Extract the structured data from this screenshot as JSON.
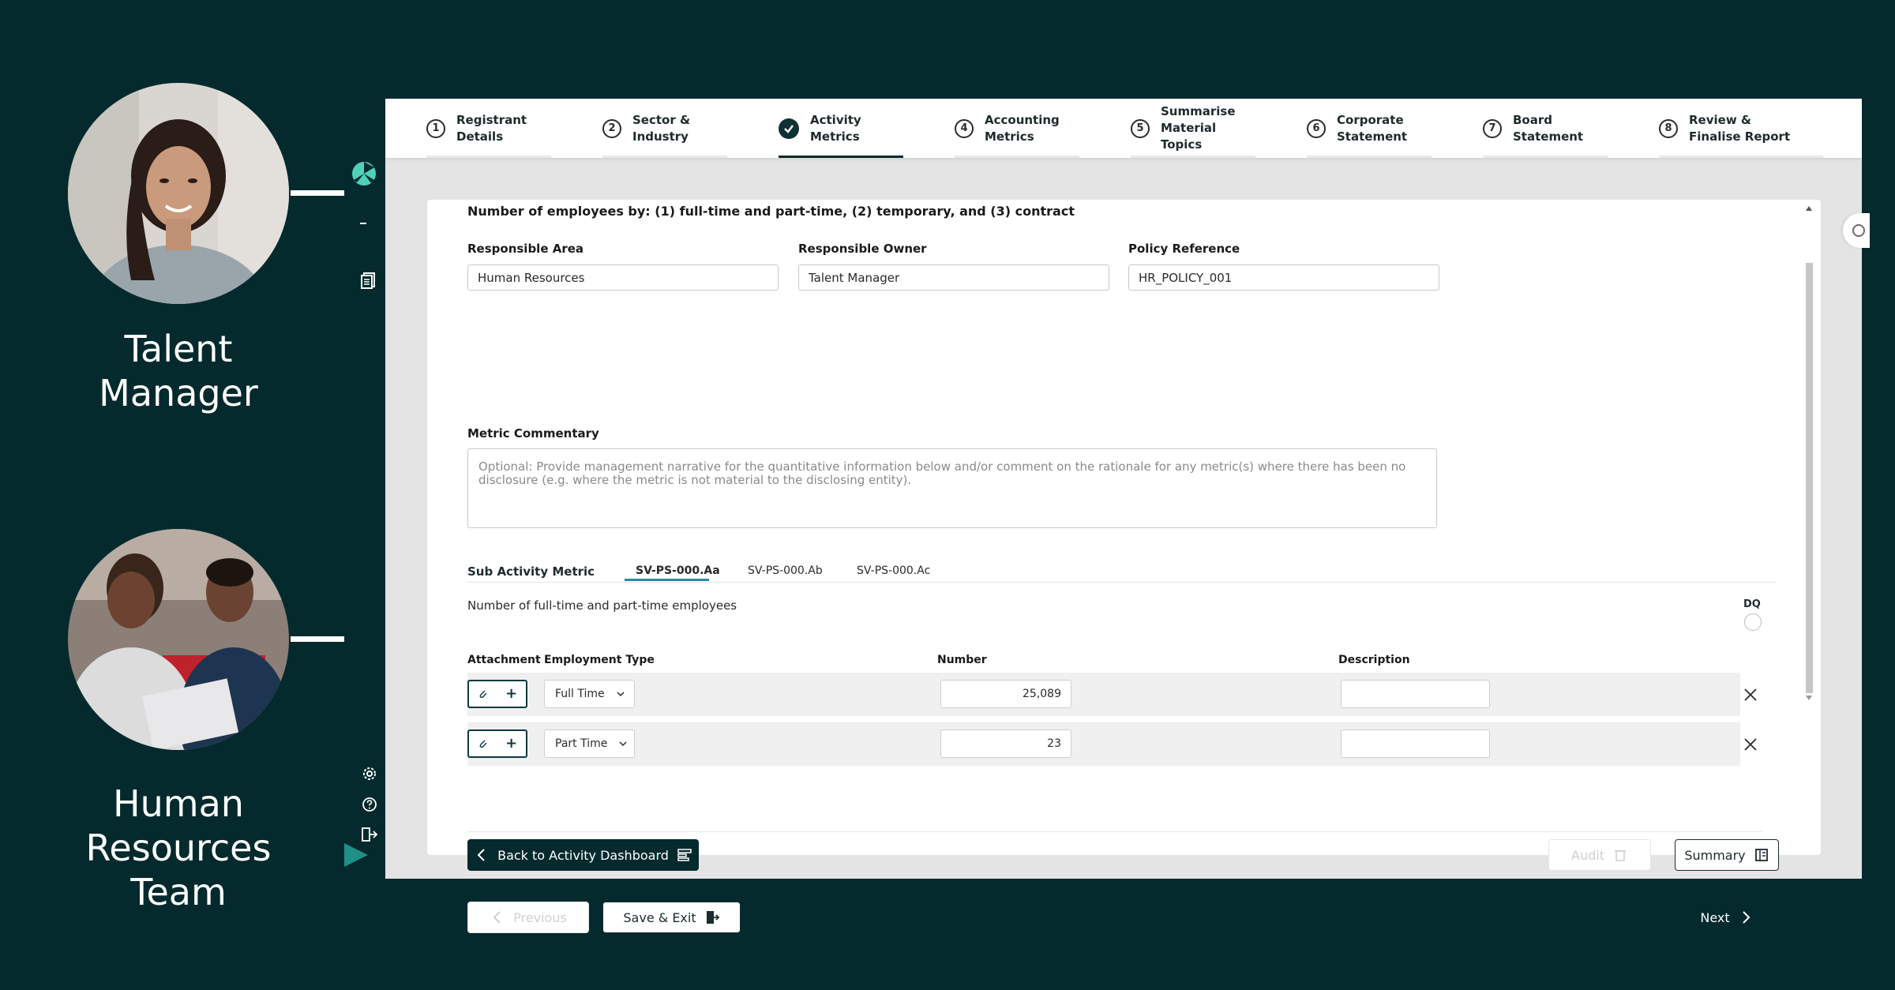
{
  "personas": [
    {
      "name": "Talent\nManager"
    },
    {
      "name": "Human\nResources\nTeam"
    }
  ],
  "steps": [
    {
      "number": "1",
      "label": "Registrant\nDetails",
      "state": "pending"
    },
    {
      "number": "2",
      "label": "Sector &\nIndustry",
      "state": "pending"
    },
    {
      "number": "3",
      "label": "Activity\nMetrics",
      "state": "active"
    },
    {
      "number": "4",
      "label": "Accounting\nMetrics",
      "state": "pending"
    },
    {
      "number": "5",
      "label": "Summarise\nMaterial Topics",
      "state": "pending"
    },
    {
      "number": "6",
      "label": "Corporate\nStatement",
      "state": "pending"
    },
    {
      "number": "7",
      "label": "Board\nStatement",
      "state": "pending"
    },
    {
      "number": "8",
      "label": "Review &\nFinalise Report",
      "state": "pending"
    }
  ],
  "form": {
    "section_title": "Number of employees by: (1) full-time and part-time, (2) temporary, and (3) contract",
    "responsible_area": {
      "label": "Responsible Area",
      "value": "Human Resources"
    },
    "responsible_owner": {
      "label": "Responsible Owner",
      "value": "Talent Manager"
    },
    "policy_reference": {
      "label": "Policy Reference",
      "value": "HR_POLICY_001"
    },
    "commentary": {
      "label": "Metric Commentary",
      "placeholder": "Optional: Provide management narrative for the quantitative information below and/or comment on the rationale for any metric(s) where there has been no disclosure (e.g. where the metric is not material to the disclosing entity)."
    }
  },
  "sub_activity": {
    "label": "Sub Activity Metric",
    "tabs": [
      "SV-PS-000.Aa",
      "SV-PS-000.Ab",
      "SV-PS-000.Ac"
    ],
    "active_tab": 0,
    "description": "Number of full-time and part-time employees",
    "dq_label": "DQ"
  },
  "table": {
    "headers": {
      "attachment": "Attachment",
      "employment_type": "Employment Type",
      "number": "Number",
      "description": "Description"
    },
    "rows": [
      {
        "employment_type": "Full Time",
        "number": "25,089",
        "description": ""
      },
      {
        "employment_type": "Part Time",
        "number": "23",
        "description": ""
      }
    ]
  },
  "buttons": {
    "back": "Back to Activity Dashboard",
    "audit": "Audit",
    "summary": "Summary",
    "previous": "Previous",
    "save_exit": "Save & Exit",
    "next": "Next"
  },
  "colors": {
    "brand_dark": "#042a2d",
    "accent": "#2a8ba6",
    "logo_teal": "#4fd1b9"
  }
}
